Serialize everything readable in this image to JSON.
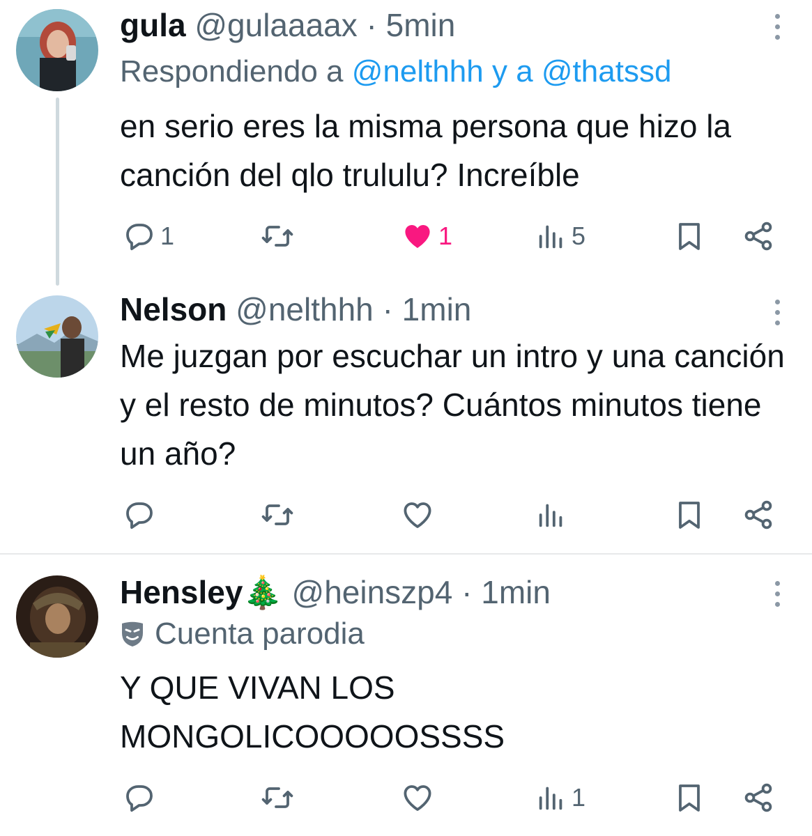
{
  "tweets": [
    {
      "name": "gula",
      "handle": "@gulaaaax",
      "separator": "·",
      "time": "5min",
      "replying_prefix": "Respondiendo a",
      "replying_to": "@nelthhh y a @thatssd",
      "text": "en serio eres la misma persona que hizo la canción del qlo trululu? Increíble",
      "actions": {
        "replies": "1",
        "retweets": "",
        "likes": "1",
        "views": "5"
      },
      "liked": true
    },
    {
      "name": "Nelson",
      "handle": "@nelthhh",
      "separator": "·",
      "time": "1min",
      "text": "Me juzgan por escuchar un intro y una canción y el resto de minutos? Cuántos minutos tiene un año?",
      "actions": {
        "replies": "",
        "retweets": "",
        "likes": "",
        "views": ""
      },
      "liked": false
    },
    {
      "name": "Hensley🎄",
      "handle": "@heinszp4",
      "separator": "·",
      "time": "1min",
      "parody_label": "Cuenta parodia",
      "text": "Y QUE VIVAN LOS MONGOLICOOOOOSSSS",
      "actions": {
        "replies": "",
        "retweets": "",
        "likes": "",
        "views": "1"
      },
      "liked": false
    }
  ],
  "colors": {
    "like": "#f91880",
    "link": "#1d9bf0",
    "muted": "#536471",
    "text": "#0f1419",
    "divider": "#e7e9ea",
    "thread_line": "#cfd9de"
  },
  "icons": [
    "reply-icon",
    "retweet-icon",
    "heart-icon",
    "views-icon",
    "bookmark-icon",
    "share-icon",
    "more-icon",
    "parody-mask-icon"
  ]
}
